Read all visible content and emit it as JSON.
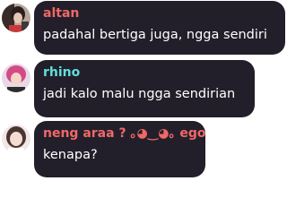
{
  "colors": {
    "bubble_bg": "#221f2a",
    "message_text": "#ffffff"
  },
  "messages": [
    {
      "username": "altan",
      "name_color": "#f06868",
      "text": "padahal bertiga juga, ngga sendiri",
      "avatar": "altan-avatar"
    },
    {
      "username": "rhino",
      "name_color": "#62dedb",
      "text": "jadi kalo malu ngga sendirian",
      "avatar": "rhino-avatar"
    },
    {
      "username": "neng araa ? ｡◕‿◕｡ ego",
      "name_color": "#f06868",
      "text": "kenapa?",
      "avatar": "neng-araa-avatar"
    }
  ]
}
